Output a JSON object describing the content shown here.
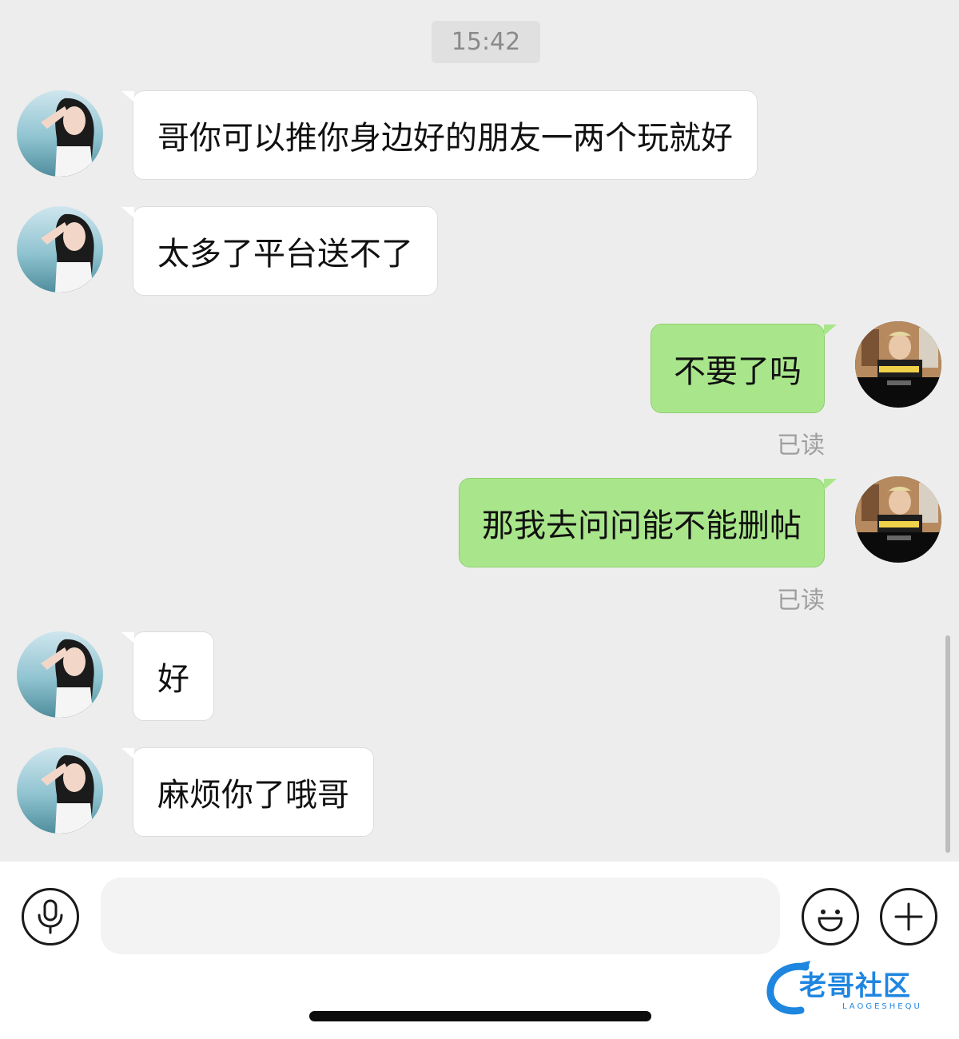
{
  "chat": {
    "timestamp": "15:42",
    "messages": [
      {
        "side": "in",
        "text": "哥你可以推你身边好的朋友一两个玩就好"
      },
      {
        "side": "in",
        "text": "太多了平台送不了"
      },
      {
        "side": "out",
        "text": "不要了吗",
        "status": "已读"
      },
      {
        "side": "out",
        "text": "那我去问问能不能删帖",
        "status": "已读"
      },
      {
        "side": "in",
        "text": "好"
      },
      {
        "side": "in",
        "text": "麻烦你了哦哥"
      }
    ]
  },
  "input_bar": {
    "voice_icon": "microphone-icon",
    "emoji_icon": "smiley-icon",
    "plus_icon": "plus-icon",
    "placeholder": ""
  },
  "watermark": {
    "text": "老哥社区",
    "subtext": "LAOGESHEQU"
  },
  "colors": {
    "background": "#ededed",
    "incoming_bubble": "#ffffff",
    "outgoing_bubble": "#a9e68b",
    "watermark": "#1f86e0"
  }
}
